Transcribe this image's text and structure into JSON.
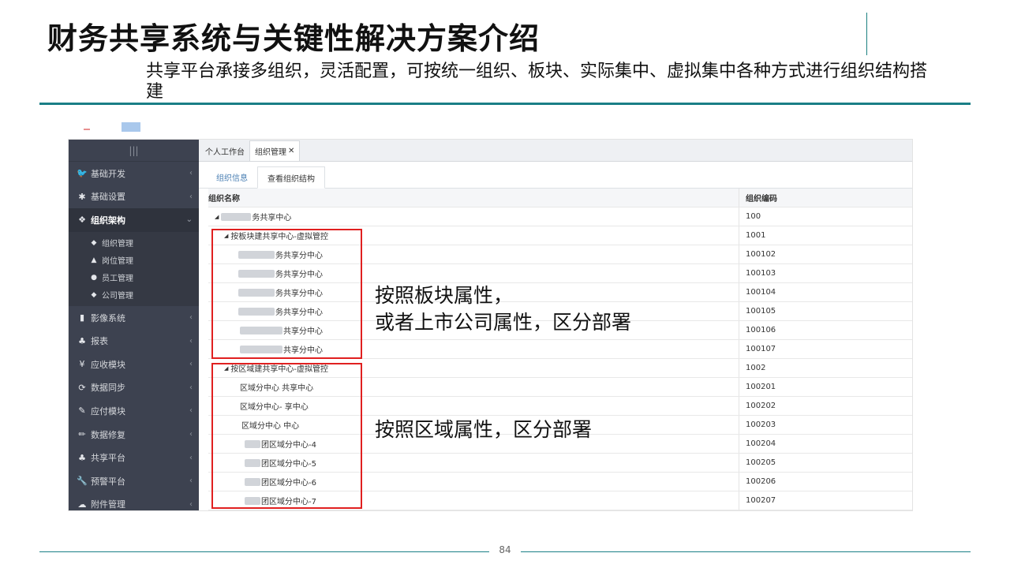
{
  "slide": {
    "title": "财务共享系统与关键性解决方案介绍",
    "subtitle": "共享平台承接多组织，灵活配置，可按统一组织、板块、实际集中、虚拟集中各种方式进行组织结构搭建",
    "page_number": "84"
  },
  "sidebar": {
    "toggle_icon": "menu-icon",
    "items": [
      {
        "label": "基础开发",
        "icon": "twitter-bird-icon"
      },
      {
        "label": "基础设置",
        "icon": "asterisk-icon"
      },
      {
        "label": "组织架构",
        "icon": "cubes-icon",
        "expanded": true
      },
      {
        "label": "影像系统",
        "icon": "file-icon"
      },
      {
        "label": "报表",
        "icon": "sitemap-icon"
      },
      {
        "label": "应收模块",
        "icon": "yen-icon"
      },
      {
        "label": "数据同步",
        "icon": "refresh-icon"
      },
      {
        "label": "应付模块",
        "icon": "wrench-hand-icon"
      },
      {
        "label": "数据修复",
        "icon": "pencil-icon"
      },
      {
        "label": "共享平台",
        "icon": "sitemap-icon"
      },
      {
        "label": "预警平台",
        "icon": "wrench-icon"
      },
      {
        "label": "附件管理",
        "icon": "cloud-icon"
      }
    ],
    "subitems": [
      {
        "label": "组织管理",
        "icon": "cube-icon"
      },
      {
        "label": "岗位管理",
        "icon": "lock-icon"
      },
      {
        "label": "员工管理",
        "icon": "user-icon"
      },
      {
        "label": "公司管理",
        "icon": "cube-icon"
      }
    ]
  },
  "tabs": [
    {
      "label": "个人工作台",
      "active": false
    },
    {
      "label": "组织管理",
      "active": true,
      "close": "✕"
    }
  ],
  "subtabs": [
    {
      "label": "组织信息",
      "active": false
    },
    {
      "label": "查看组织结构",
      "active": true
    }
  ],
  "table": {
    "columns": [
      "组织名称",
      "组织编码"
    ],
    "rows": [
      {
        "name": "务共享中心",
        "code": "100"
      },
      {
        "name": "按板块建共享中心-虚拟管控",
        "code": "1001"
      },
      {
        "name": "务共享分中心",
        "code": "100102"
      },
      {
        "name": "务共享分中心",
        "code": "100103"
      },
      {
        "name": "务共享分中心",
        "code": "100104"
      },
      {
        "name": "务共享分中心",
        "code": "100105"
      },
      {
        "name": "共享分中心",
        "code": "100106"
      },
      {
        "name": "共享分中心",
        "code": "100107"
      },
      {
        "name": "按区域建共享中心-虚拟管控",
        "code": "1002"
      },
      {
        "name": "区域分中心 共享中心",
        "code": "100201"
      },
      {
        "name": "区域分中心- 享中心",
        "code": "100202"
      },
      {
        "name": "区域分中心 中心",
        "code": "100203"
      },
      {
        "name": "团区域分中心-4",
        "code": "100204"
      },
      {
        "name": "团区域分中心-5",
        "code": "100205"
      },
      {
        "name": "团区域分中心-6",
        "code": "100206"
      },
      {
        "name": "团区域分中心-7",
        "code": "100207"
      }
    ]
  },
  "annotations": {
    "block1": "按照板块属性，\n或者上市公司属性，区分部署",
    "block2": "按照区域属性，区分部署"
  },
  "colors": {
    "teal": "#1a7f86",
    "sidebar_bg": "#3d4250",
    "highlight_red": "#e02020"
  }
}
